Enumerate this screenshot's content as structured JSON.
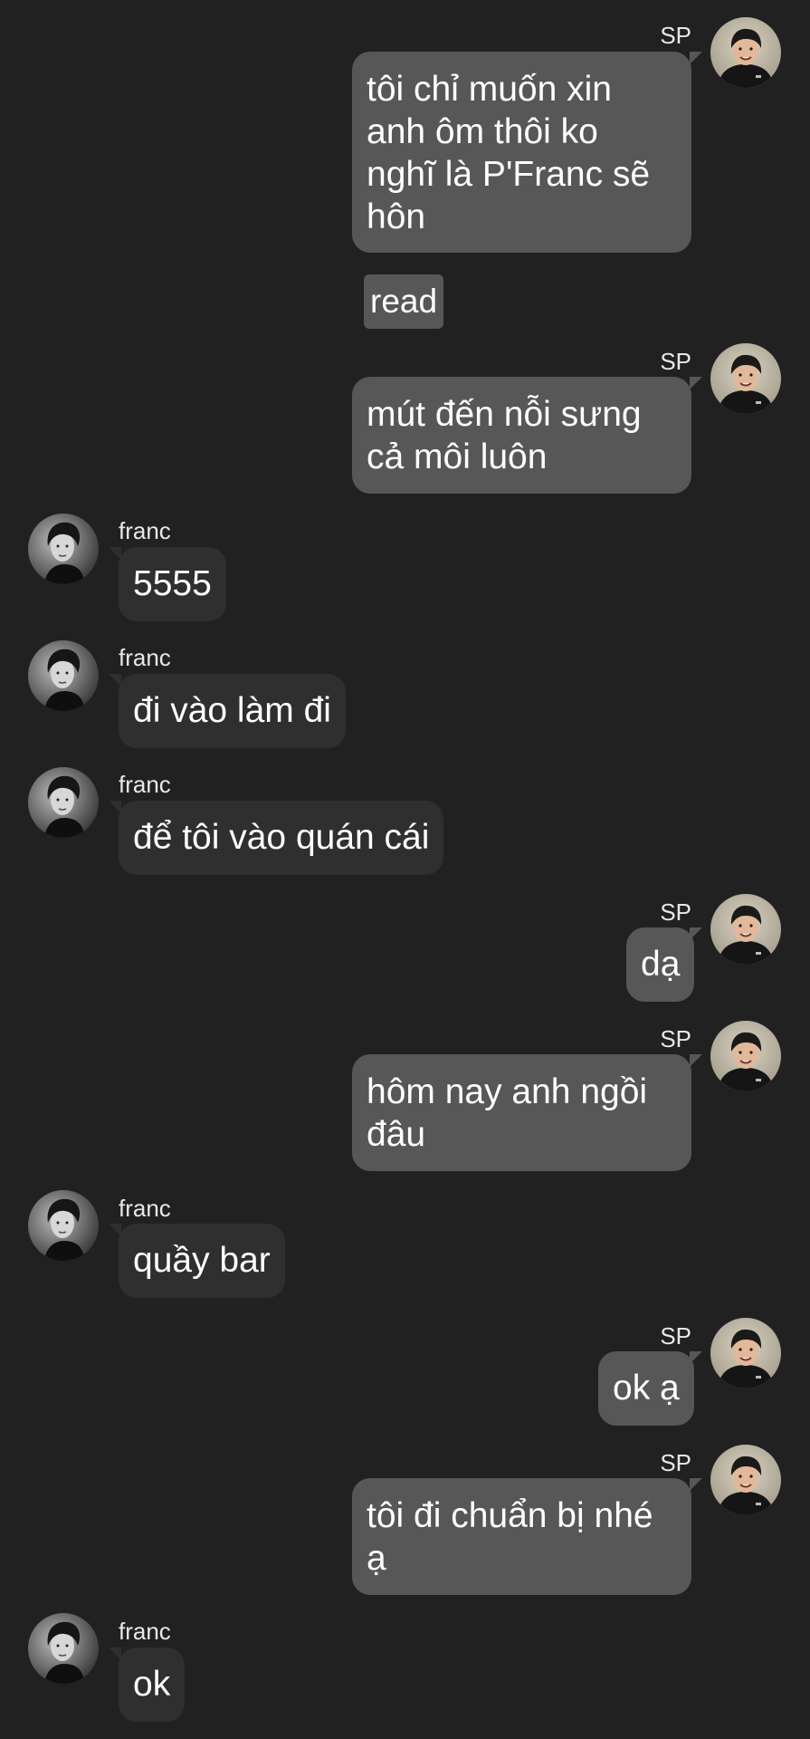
{
  "messages": [
    {
      "sender": "SP",
      "text": "tôi chỉ muốn xin anh ôm thôi ko nghĩ là P'Franc sẽ hôn",
      "lines": [
        "tôi chỉ muốn xin",
        "anh ôm thôi ko",
        "nghĩ là P'Franc sẽ",
        "hôn"
      ]
    },
    {
      "status": "read"
    },
    {
      "sender": "SP",
      "text": "mút đến nỗi sưng cả môi luôn",
      "lines": [
        "mút đến nỗi sưng",
        "cả môi luôn"
      ]
    },
    {
      "sender": "franc",
      "text": "5555"
    },
    {
      "sender": "franc",
      "text": "đi vào làm đi"
    },
    {
      "sender": "franc",
      "text": "để tôi vào quán cái"
    },
    {
      "sender": "SP",
      "text": "dạ"
    },
    {
      "sender": "SP",
      "text": "hôm nay anh ngồi đâu",
      "lines": [
        "hôm nay anh ngồi",
        "đâu"
      ]
    },
    {
      "sender": "franc",
      "text": "quầy bar"
    },
    {
      "sender": "SP",
      "text": "ok ạ"
    },
    {
      "sender": "SP",
      "text": "tôi đi chuẩn bị nhé ạ",
      "lines": [
        "tôi đi chuẩn bị nhé",
        "ạ"
      ]
    },
    {
      "sender": "franc",
      "text": "ok"
    }
  ],
  "icons": {
    "sp_avatar": "sp-avatar-icon",
    "franc_avatar": "franc-avatar-icon"
  },
  "colors": {
    "background": "#212121",
    "outgoing_bubble": "#575757",
    "incoming_bubble": "#2f2f2f",
    "text": "#ffffff"
  }
}
